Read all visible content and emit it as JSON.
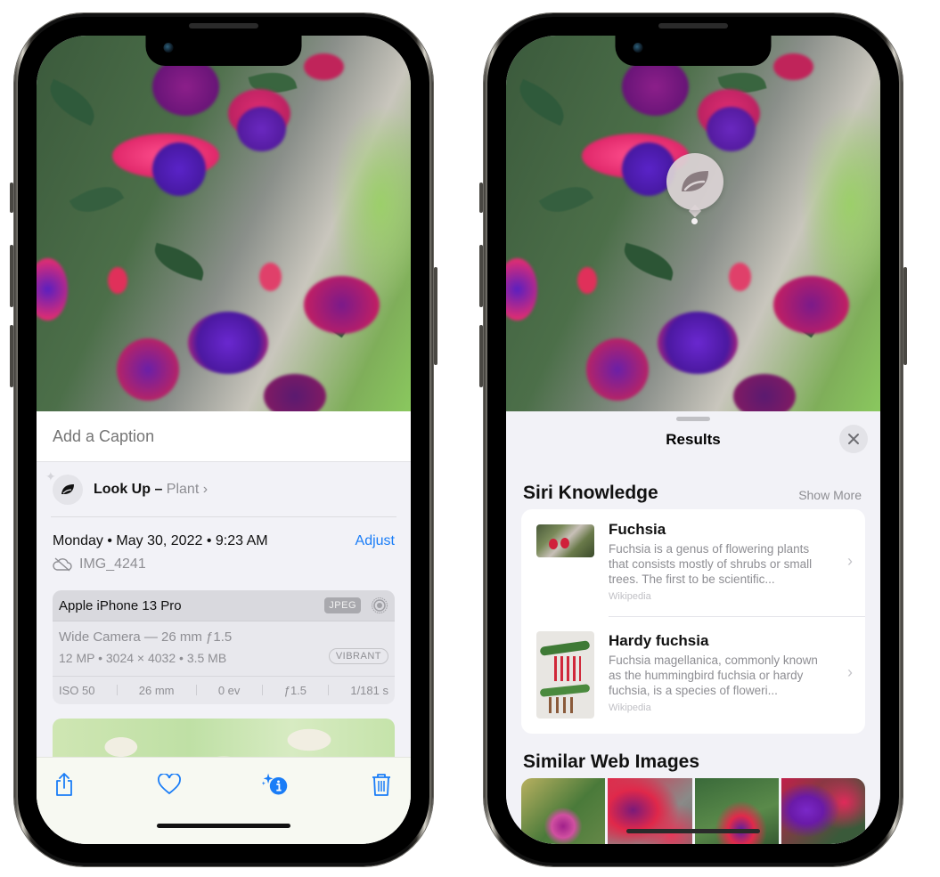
{
  "left_phone": {
    "caption": {
      "placeholder": "Add a Caption",
      "value": ""
    },
    "lookup": {
      "label": "Look Up –",
      "subject": "Plant",
      "chevron": "›",
      "icon": "leaf-icon"
    },
    "datetime": "Monday • May 30, 2022 • 9:23 AM",
    "adjust_label": "Adjust",
    "file": {
      "icon": "icloud-slash-icon",
      "name": "IMG_4241"
    },
    "metadata": {
      "device": "Apple iPhone 13 Pro",
      "format_badge": "JPEG",
      "lens": "Wide Camera — 26 mm ƒ1.5",
      "specs": "12 MP • 3024 × 4032 • 3.5 MB",
      "style_badge": "VIBRANT",
      "exif": [
        "ISO 50",
        "26 mm",
        "0 ev",
        "ƒ1.5",
        "1/181 s"
      ]
    },
    "toolbar": {
      "share": "share-icon",
      "favorite": "heart-icon",
      "info": "info-sparkle-icon",
      "delete": "trash-icon",
      "accent": "#1a7df7"
    }
  },
  "right_phone": {
    "sheet_title": "Results",
    "siri_knowledge": {
      "heading": "Siri Knowledge",
      "show_more": "Show More",
      "items": [
        {
          "title": "Fuchsia",
          "description": "Fuchsia is a genus of flowering plants that consists mostly of shrubs or small trees. The first to be scientific...",
          "source": "Wikipedia"
        },
        {
          "title": "Hardy fuchsia",
          "description": "Fuchsia magellanica, commonly known as the hummingbird fuchsia or hardy fuchsia, is a species of floweri...",
          "source": "Wikipedia"
        }
      ]
    },
    "similar_web_images": {
      "heading": "Similar Web Images",
      "count": 4
    }
  }
}
